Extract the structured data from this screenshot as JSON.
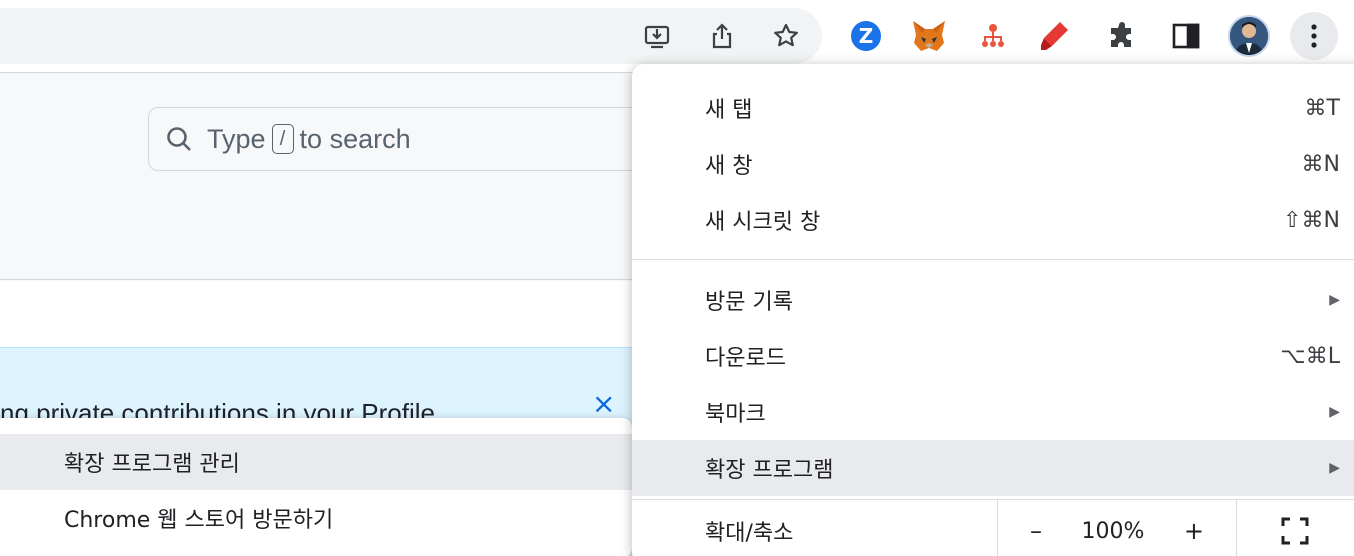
{
  "toolbar": {
    "icons": [
      "install-icon",
      "share-icon",
      "bookmark-star-icon",
      "extension-z-icon",
      "metamask-fox-icon",
      "extension-org-icon",
      "extension-marker-icon",
      "extensions-puzzle-icon",
      "side-panel-icon",
      "profile-avatar",
      "menu-kebab-icon"
    ],
    "z_label": "Z"
  },
  "page": {
    "search": {
      "prefix": "Type",
      "key": "/",
      "suffix": "to search"
    },
    "banner": {
      "text": "ng private contributions in your Profile",
      "close": "×"
    }
  },
  "menu": {
    "items": [
      {
        "label": "새 탭",
        "shortcut": "⌘T"
      },
      {
        "label": "새 창",
        "shortcut": "⌘N"
      },
      {
        "label": "새 시크릿 창",
        "shortcut": "⇧⌘N"
      },
      {
        "label": "방문 기록",
        "arrow": "▶"
      },
      {
        "label": "다운로드",
        "shortcut": "⌥⌘L"
      },
      {
        "label": "북마크",
        "arrow": "▶"
      },
      {
        "label": "확장 프로그램",
        "arrow": "▶"
      }
    ],
    "zoom": {
      "label": "확대/축소",
      "minus": "–",
      "value": "100%",
      "plus": "+"
    }
  },
  "submenu": {
    "items": [
      {
        "label": "확장 프로그램 관리"
      },
      {
        "label": "Chrome 웹 스토어 방문하기"
      }
    ]
  },
  "colors": {
    "accent": "#1a73e8",
    "menu_highlight": "#e8eaed",
    "banner_bg": "#ddf4ff",
    "close_blue": "#0969da"
  }
}
